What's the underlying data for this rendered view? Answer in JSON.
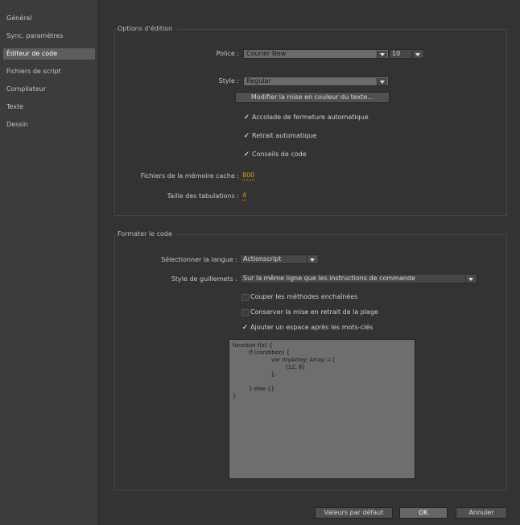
{
  "sidebar": {
    "items": [
      {
        "label": "Général",
        "active": false
      },
      {
        "label": "Sync. paramètres",
        "active": false
      },
      {
        "label": "Éditeur de code",
        "active": true
      },
      {
        "label": "Fichiers de script",
        "active": false
      },
      {
        "label": "Compilateur",
        "active": false
      },
      {
        "label": "Texte",
        "active": false
      },
      {
        "label": "Dessin",
        "active": false
      }
    ]
  },
  "editing": {
    "title": "Options d'édition",
    "font_label": "Police :",
    "font_value": "Courier New",
    "size_value": "10",
    "style_label": "Style :",
    "style_value": "Regular",
    "color_button": "Modifier la mise en couleur du texte...",
    "checks": [
      {
        "label": "Accolade de fermeture automatique",
        "checked": true
      },
      {
        "label": "Retrait automatique",
        "checked": true
      },
      {
        "label": "Conseils de code",
        "checked": true
      }
    ],
    "cache_label": "Fichiers de la mémoire cache :",
    "cache_value": "800",
    "tab_label": "Taille des tabulations :",
    "tab_value": "4"
  },
  "format": {
    "title": "Formater le code",
    "language_label": "Sélectionner la langue :",
    "language_value": "Actionscript",
    "brace_label": "Style de guillemets :",
    "brace_value": "Sur la même ligne que les instructions de commande",
    "checks": [
      {
        "label": "Couper les méthodes enchaînées",
        "checked": false
      },
      {
        "label": "Conserver la mise en retrait de la plage",
        "checked": false
      },
      {
        "label": "Ajouter un espace après les mots-clés",
        "checked": true
      }
    ],
    "preview_lines": [
      "function f(x) {",
      "if (condition) {",
      "var myArray: Array = [",
      "[12, 6]",
      "];",
      "} else {}",
      "}"
    ]
  },
  "footer": {
    "defaults": "Valeurs par défaut",
    "ok": "OK",
    "cancel": "Annuler"
  },
  "colors": {
    "background": "#333333",
    "sidebar": "#3c3c3c",
    "active_item": "#5d5d5d",
    "accent_value": "#e0a000"
  },
  "icons": {
    "check": "checkmark-icon",
    "dropdown": "chevron-down-icon"
  }
}
